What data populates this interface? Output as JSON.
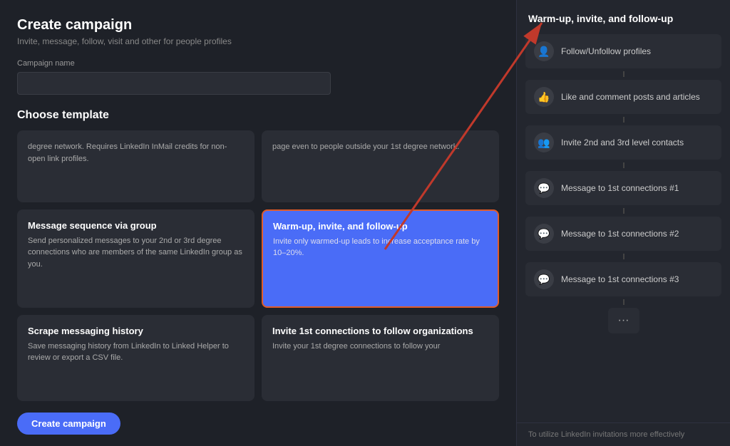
{
  "header": {
    "title": "Create campaign",
    "subtitle": "Invite, message, follow, visit and other for people profiles"
  },
  "campaign_name": {
    "label": "Campaign name",
    "placeholder": ""
  },
  "choose_template": {
    "title": "Choose template"
  },
  "templates": [
    {
      "id": "t1",
      "title": "...",
      "desc": "degree network. Requires LinkedIn InMail credits for non-open link profiles.",
      "highlighted": false
    },
    {
      "id": "t2",
      "title": "...",
      "desc": "page even to people outside your 1st degree network.",
      "highlighted": false
    },
    {
      "id": "t3",
      "title": "Message sequence via group",
      "desc": "Send personalized messages to your 2nd or 3rd degree connections who are members of the same LinkedIn group as you.",
      "highlighted": false
    },
    {
      "id": "t4",
      "title": "Warm-up, invite, and follow-up",
      "desc": "Invite only warmed-up leads to increase acceptance rate by 10–20%.",
      "highlighted": true
    },
    {
      "id": "t5",
      "title": "Scrape messaging history",
      "desc": "Save messaging history from LinkedIn to Linked Helper to review or export a CSV file.",
      "highlighted": false
    },
    {
      "id": "t6",
      "title": "Invite 1st connections to follow organizations",
      "desc": "Invite your 1st degree connections to follow your",
      "highlighted": false
    }
  ],
  "create_button": {
    "label": "Create campaign"
  },
  "right_panel": {
    "title": "Warm-up, invite, and follow-up",
    "items": [
      {
        "icon": "👤",
        "label": "Follow/Unfollow profiles"
      },
      {
        "icon": "👍",
        "label": "Like and comment posts and articles"
      },
      {
        "icon": "👥",
        "label": "Invite 2nd and 3rd level contacts"
      },
      {
        "icon": "💬",
        "label": "Message to 1st connections #1"
      },
      {
        "icon": "💬",
        "label": "Message to 1st connections #2"
      },
      {
        "icon": "💬",
        "label": "Message to 1st connections #3"
      }
    ],
    "more_label": "···",
    "footer": "To utilize LinkedIn invitations more effectively"
  }
}
